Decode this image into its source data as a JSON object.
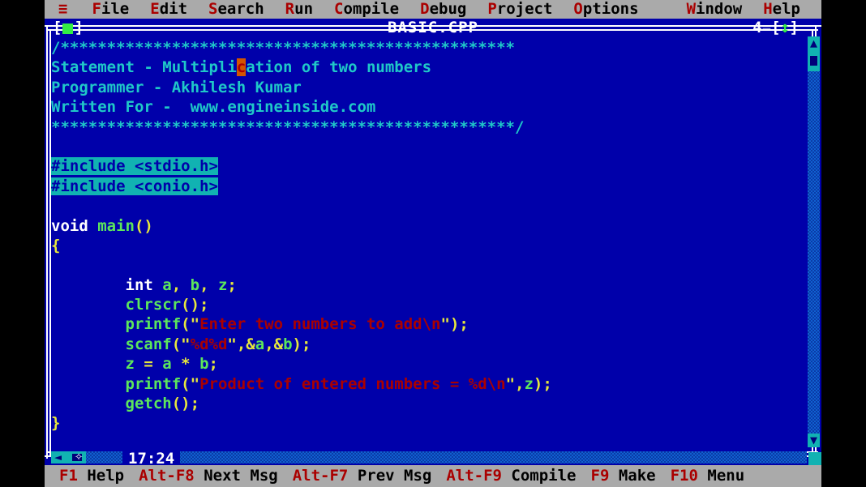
{
  "menubar": {
    "hamburger_icon": "≡",
    "items": [
      {
        "hot": "F",
        "rest": "ile"
      },
      {
        "hot": "E",
        "rest": "dit"
      },
      {
        "hot": "S",
        "rest": "earch"
      },
      {
        "hot": "R",
        "rest": "un"
      },
      {
        "hot": "C",
        "rest": "ompile"
      },
      {
        "hot": "D",
        "rest": "ebug"
      },
      {
        "hot": "P",
        "rest": "roject"
      },
      {
        "hot": "O",
        "rest": "ptions"
      }
    ],
    "right_items": [
      {
        "hot": "W",
        "rest": "indow"
      },
      {
        "hot": "H",
        "rest": "elp"
      }
    ]
  },
  "window": {
    "title": "BASIC.CPP",
    "close_box_left": "[",
    "close_box_right": "]",
    "number": "4",
    "number_separator": "=",
    "resize_left": "[",
    "resize_glyph": "↕",
    "resize_right": "]"
  },
  "editor": {
    "cursor_char": "c",
    "line_col": "17:24",
    "lines": [
      [
        {
          "t": "comment",
          "s": "/*************************************************"
        }
      ],
      [
        {
          "t": "comment",
          "s": "Statement - Multipli"
        },
        {
          "t": "cursor",
          "s": "c"
        },
        {
          "t": "comment",
          "s": "ation of two numbers"
        }
      ],
      [
        {
          "t": "comment",
          "s": "Programmer - Akhilesh Kumar"
        }
      ],
      [
        {
          "t": "comment",
          "s": "Written For -  www.engineinside.com"
        }
      ],
      [
        {
          "t": "comment",
          "s": "**************************************************/"
        }
      ],
      [],
      [
        {
          "t": "preproc",
          "s": "#include <stdio.h>"
        }
      ],
      [
        {
          "t": "preproc",
          "s": "#include <conio.h>"
        }
      ],
      [],
      [
        {
          "t": "key",
          "s": "void "
        },
        {
          "t": "ident",
          "s": "main"
        },
        {
          "t": "punct",
          "s": "()"
        }
      ],
      [
        {
          "t": "punct",
          "s": "{"
        }
      ],
      [],
      [
        {
          "t": "key",
          "s": "        int "
        },
        {
          "t": "ident",
          "s": "a"
        },
        {
          "t": "punct",
          "s": ", "
        },
        {
          "t": "ident",
          "s": "b"
        },
        {
          "t": "punct",
          "s": ", "
        },
        {
          "t": "ident",
          "s": "z"
        },
        {
          "t": "punct",
          "s": ";"
        }
      ],
      [
        {
          "t": "ident",
          "s": "        clrscr"
        },
        {
          "t": "punct",
          "s": "();"
        }
      ],
      [
        {
          "t": "ident",
          "s": "        printf"
        },
        {
          "t": "punct",
          "s": "("
        },
        {
          "t": "quote",
          "s": "\""
        },
        {
          "t": "str",
          "s": "Enter two numbers to add\\n"
        },
        {
          "t": "quote",
          "s": "\""
        },
        {
          "t": "punct",
          "s": ");"
        }
      ],
      [
        {
          "t": "ident",
          "s": "        scanf"
        },
        {
          "t": "punct",
          "s": "("
        },
        {
          "t": "quote",
          "s": "\""
        },
        {
          "t": "str",
          "s": "%d%d"
        },
        {
          "t": "quote",
          "s": "\""
        },
        {
          "t": "punct",
          "s": ",&"
        },
        {
          "t": "ident",
          "s": "a"
        },
        {
          "t": "punct",
          "s": ",&"
        },
        {
          "t": "ident",
          "s": "b"
        },
        {
          "t": "punct",
          "s": ");"
        }
      ],
      [
        {
          "t": "ident",
          "s": "        z"
        },
        {
          "t": "punct",
          "s": " = "
        },
        {
          "t": "ident",
          "s": "a"
        },
        {
          "t": "punct",
          "s": " * "
        },
        {
          "t": "ident",
          "s": "b"
        },
        {
          "t": "punct",
          "s": ";"
        }
      ],
      [
        {
          "t": "ident",
          "s": "        printf"
        },
        {
          "t": "punct",
          "s": "("
        },
        {
          "t": "quote",
          "s": "\""
        },
        {
          "t": "str",
          "s": "Product of entered numbers = %d\\n"
        },
        {
          "t": "quote",
          "s": "\""
        },
        {
          "t": "punct",
          "s": ","
        },
        {
          "t": "ident",
          "s": "z"
        },
        {
          "t": "punct",
          "s": ");"
        }
      ],
      [
        {
          "t": "ident",
          "s": "        getch"
        },
        {
          "t": "punct",
          "s": "();"
        }
      ],
      [
        {
          "t": "punct",
          "s": "}"
        }
      ]
    ]
  },
  "scrollbars": {
    "v_up_icon": "▲",
    "v_down_icon": "▼",
    "h_left_icon": "◄",
    "h_right_icon": "►"
  },
  "statusbar": {
    "items": [
      {
        "key": "F1",
        "label": "Help"
      },
      {
        "key": "Alt-F8",
        "label": "Next Msg"
      },
      {
        "key": "Alt-F7",
        "label": "Prev Msg"
      },
      {
        "key": "Alt-F9",
        "label": "Compile"
      },
      {
        "key": "F9",
        "label": "Make"
      },
      {
        "key": "F10",
        "label": "Menu"
      }
    ]
  },
  "colors": {
    "desktop_blue": "#0000aa",
    "menubar_gray": "#aaaaaa",
    "hotkey_red": "#aa0000",
    "comment_cyan": "#1fc8c8",
    "identifier_green": "#5ce65c",
    "punct_yellow": "#e8e83c",
    "string_red": "#aa0000",
    "preproc_bg": "#11b2b2",
    "cursor_orange": "#d45500"
  }
}
